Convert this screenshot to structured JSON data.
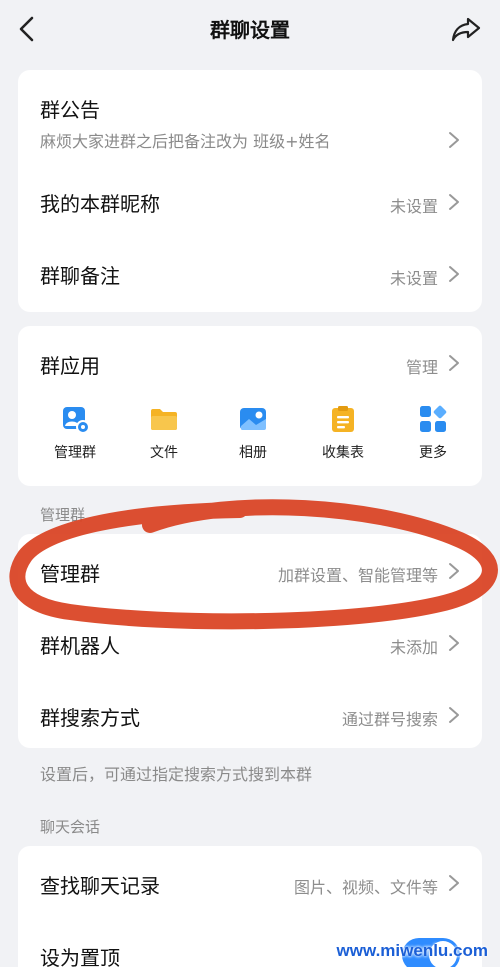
{
  "header": {
    "title": "群聊设置",
    "back_icon": "chevron-left-icon",
    "share_icon": "share-icon"
  },
  "info_card": {
    "announcement": {
      "title": "群公告",
      "subtitle": "麻烦大家进群之后把备注改为 班级+姓名"
    },
    "nickname": {
      "title": "我的本群昵称",
      "value": "未设置"
    },
    "remark": {
      "title": "群聊备注",
      "value": "未设置"
    }
  },
  "apps_card": {
    "title": "群应用",
    "manage_label": "管理",
    "apps": [
      {
        "label": "管理群",
        "icon": "manage-group-icon",
        "color": "#2a8cf0"
      },
      {
        "label": "文件",
        "icon": "folder-icon",
        "color": "#f5b324"
      },
      {
        "label": "相册",
        "icon": "album-icon",
        "color": "#2a8cf0"
      },
      {
        "label": "收集表",
        "icon": "clipboard-icon",
        "color": "#f5b324"
      },
      {
        "label": "更多",
        "icon": "more-grid-icon",
        "color": "#2a8cf0"
      }
    ]
  },
  "manage_section": {
    "label": "管理群",
    "manage": {
      "title": "管理群",
      "value": "加群设置、智能管理等"
    },
    "robot": {
      "title": "群机器人",
      "value": "未添加"
    },
    "search": {
      "title": "群搜索方式",
      "value": "通过群号搜索"
    },
    "hint": "设置后，可通过指定搜索方式搜到本群"
  },
  "chat_section": {
    "label": "聊天会话",
    "history": {
      "title": "查找聊天记录",
      "value": "图片、视频、文件等"
    },
    "pin": {
      "title": "设为置顶",
      "enabled": true
    }
  },
  "watermark": "www.miwenlu.com",
  "colors": {
    "background": "#f1f2f5",
    "card": "#ffffff",
    "accent": "#2f8cff",
    "annotation": "#d9401f"
  }
}
